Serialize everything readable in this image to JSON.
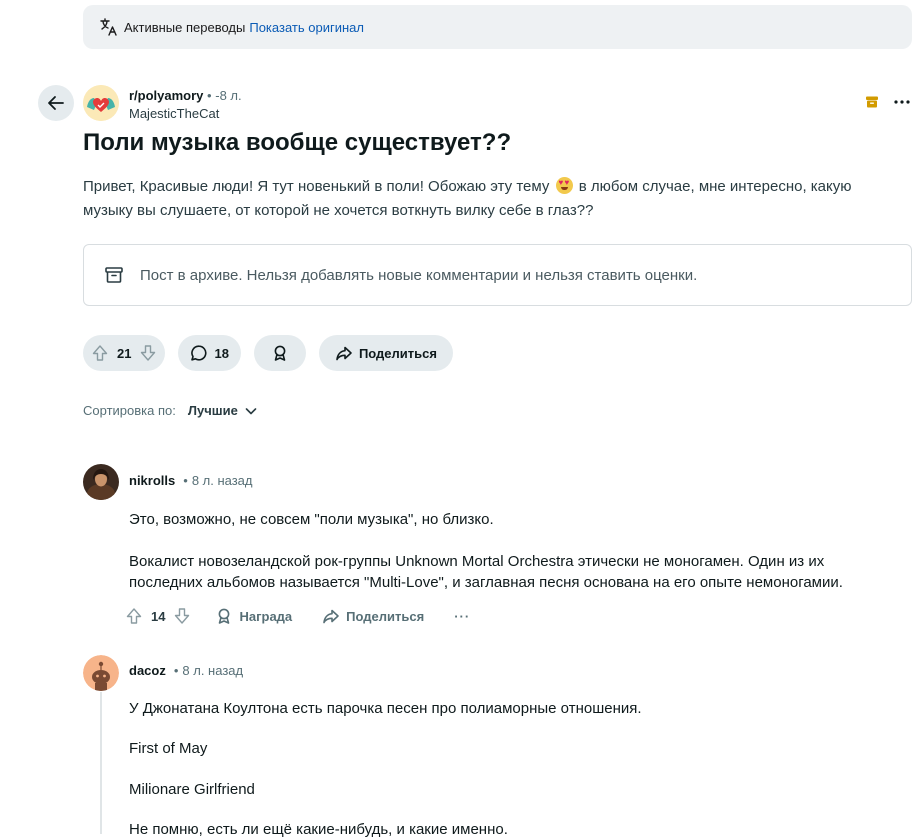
{
  "banner": {
    "icon": "translate-icon",
    "text": "Активные переводы",
    "link": "Показать оригинал"
  },
  "post": {
    "subreddit": "r/polyamory",
    "separator": "•",
    "age": "-8 л.",
    "author": "MajesticTheCat",
    "title": "Поли музыка вообще существует??",
    "body_before_emoji": "Привет, Красивые люди! Я тут новенький в поли! Обожаю эту тему",
    "body_after_emoji": "в любом случае, мне интересно, какую музыку вы слушаете, от которой не хочется воткнуть вилку себе в глаз??",
    "archive_notice": "Пост в архиве. Нельзя добавлять новые комментарии и нельзя ставить оценки.",
    "votes": "21",
    "comments": "18",
    "share_label": "Поделиться"
  },
  "sort": {
    "label": "Сортировка по:",
    "value": "Лучшие"
  },
  "comments": [
    {
      "user": "nikrolls",
      "separator": "•",
      "time": "8 л. назад",
      "paragraphs": [
        "Это, возможно, не совсем \"поли музыка\", но близко.",
        "Вокалист новозеландской рок-группы Unknown Mortal Orchestra этически не моногамен. Один из их последних альбомов называется \"Multi-Love\", и заглавная песня основана на его опыте немоногамии."
      ],
      "votes": "14",
      "award_label": "Награда",
      "share_label": "Поделиться",
      "more": "···"
    },
    {
      "user": "dacoz",
      "separator": "•",
      "time": "8 л. назад",
      "paragraphs": [
        "У Джонатана Коултона есть парочка песен про полиаморные отношения.",
        "First of May",
        "Milionare Girlfriend",
        "Не помню, есть ли ещё какие-нибудь, и какие именно."
      ]
    }
  ],
  "colors": {
    "banner_bg": "#eef1f3",
    "pill_bg": "#e5ebee",
    "link": "#0a5bb5",
    "archive_badge": "#d29b00",
    "text": "#0f1a1c",
    "muted": "#576f76"
  }
}
